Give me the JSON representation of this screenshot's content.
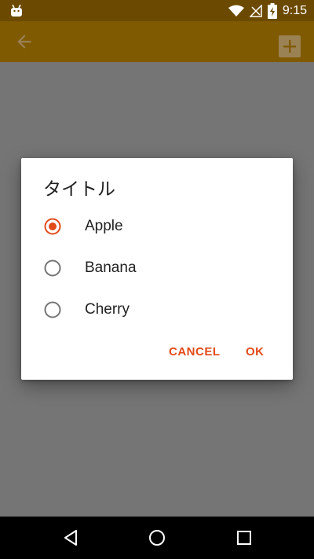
{
  "status_bar": {
    "time": "9:15",
    "icons": [
      "android-icon",
      "wifi-icon",
      "no-signal-icon",
      "battery-charging-icon"
    ]
  },
  "app_bar": {
    "back_icon": "arrow-back-icon",
    "add_icon": "plus-icon"
  },
  "dialog": {
    "title": "タイトル",
    "options": [
      {
        "label": "Apple",
        "selected": true
      },
      {
        "label": "Banana",
        "selected": false
      },
      {
        "label": "Cherry",
        "selected": false
      }
    ],
    "cancel_label": "CANCEL",
    "ok_label": "OK"
  },
  "colors": {
    "accent": "#e24a1a",
    "app_bar": "#805a00",
    "status_bar": "#6b4a00",
    "scrim": "#757575"
  },
  "nav_bar": {
    "icons": [
      "nav-back-icon",
      "nav-home-icon",
      "nav-recents-icon"
    ]
  }
}
